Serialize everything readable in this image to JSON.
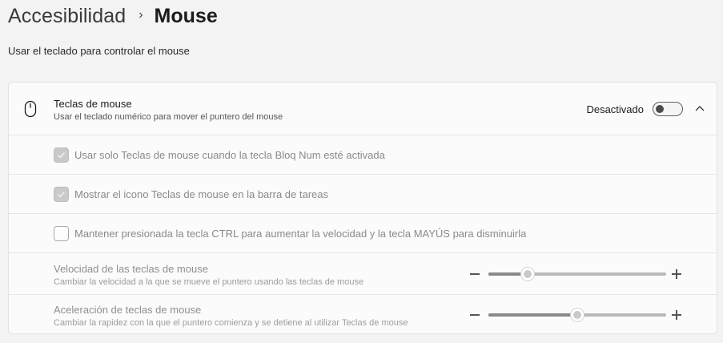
{
  "breadcrumb": {
    "parent": "Accesibilidad",
    "separator": "›",
    "current": "Mouse"
  },
  "subtitle": "Usar el teclado para controlar el mouse",
  "mouse_keys": {
    "title": "Teclas de mouse",
    "description": "Usar el teclado numérico para mover el puntero del mouse",
    "state_label": "Desactivado",
    "toggle_on": false,
    "icon": "mouse-icon",
    "expand_icon": "chevron-up-icon"
  },
  "options": [
    {
      "label": "Usar solo Teclas de mouse cuando la tecla Bloq Num esté activada",
      "checked": true
    },
    {
      "label": "Mostrar el icono Teclas de mouse en la barra de tareas",
      "checked": true
    },
    {
      "label": "Mantener presionada la tecla CTRL para aumentar la velocidad y la tecla MAYÚS para disminuirla",
      "checked": false
    }
  ],
  "sliders": [
    {
      "title": "Velocidad de las teclas de mouse",
      "description": "Cambiar la velocidad a la que se mueve el puntero usando las teclas de mouse",
      "value": 0.22
    },
    {
      "title": "Aceleración de teclas de mouse",
      "description": "Cambiar la rapidez con la que el puntero comienza y se detiene al utilizar Teclas de mouse",
      "value": 0.5
    }
  ],
  "colors": {
    "background": "#f3f3f3",
    "panel": "#fbfbfb",
    "disabled_text": "#8a8a8a"
  }
}
